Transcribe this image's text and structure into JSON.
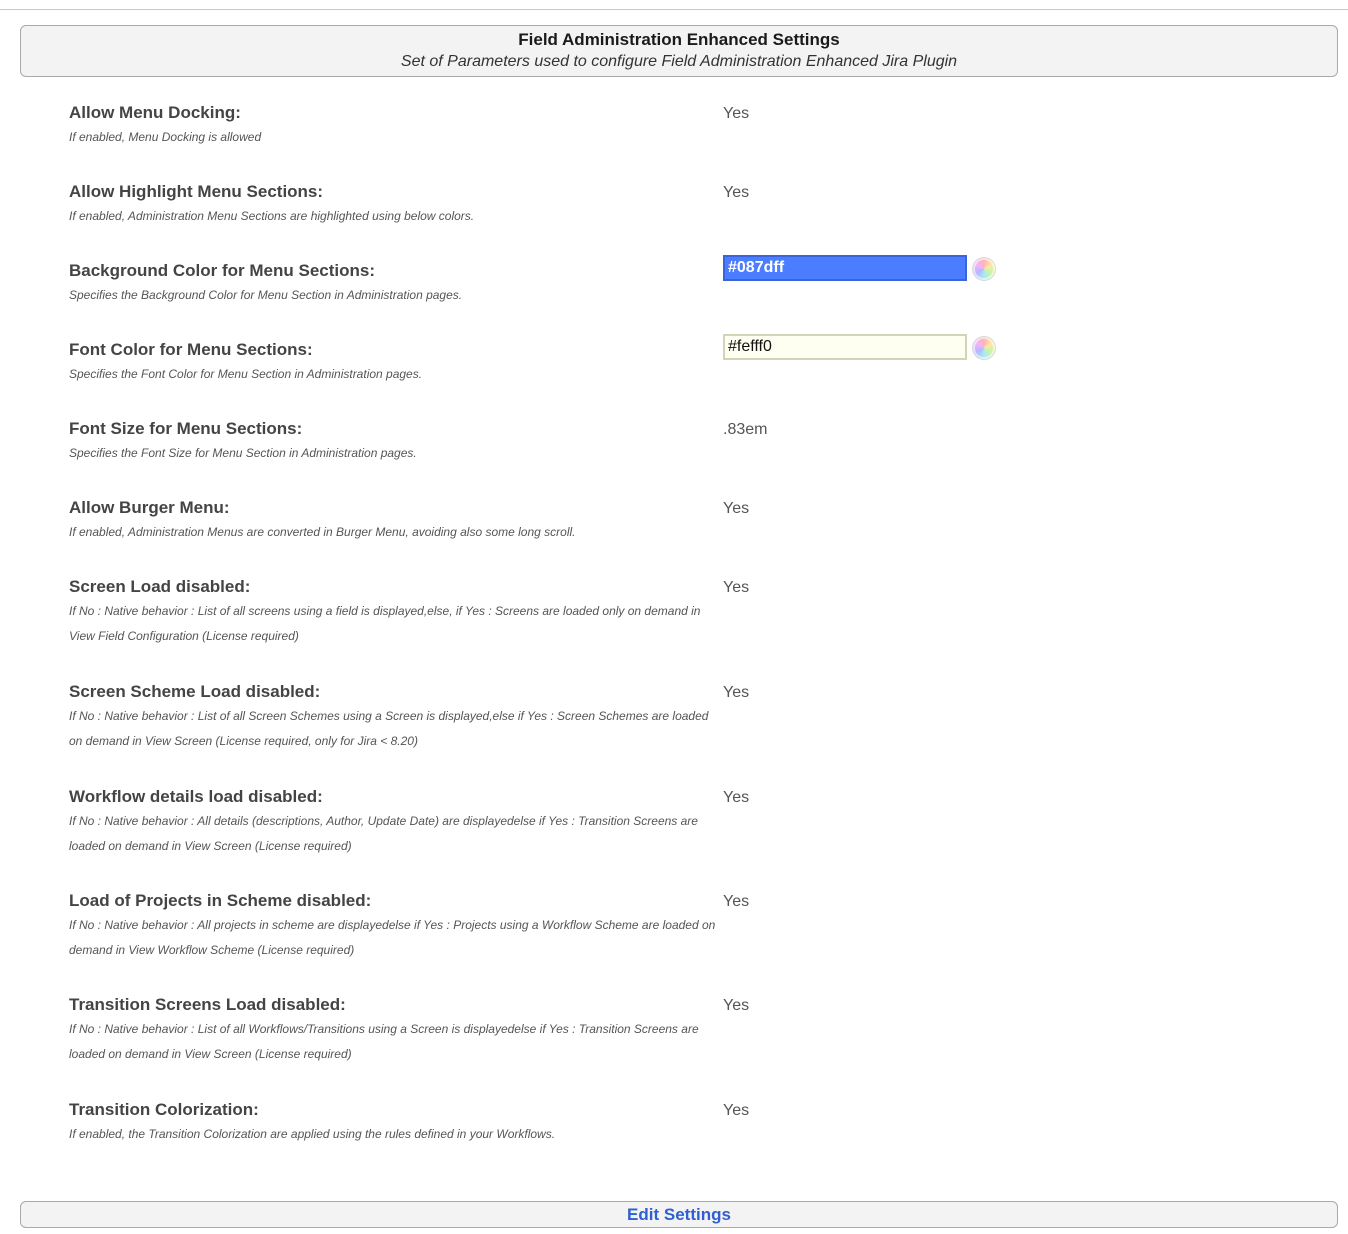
{
  "header": {
    "title": "Field Administration Enhanced Settings",
    "subtitle": "Set of Parameters used to configure Field Administration Enhanced Jira Plugin"
  },
  "settings": [
    {
      "label": "Allow Menu Docking:",
      "description": "If enabled, Menu Docking is allowed",
      "value": "Yes"
    },
    {
      "label": "Allow Highlight Menu Sections:",
      "description": "If enabled, Administration Menu Sections are highlighted using below colors.",
      "value": "Yes"
    },
    {
      "label": "Background Color for Menu Sections:",
      "description": "Specifies the Background Color for Menu Section in Administration pages.",
      "value": "#087dff"
    },
    {
      "label": "Font Color for Menu Sections:",
      "description": "Specifies the Font Color for Menu Section in Administration pages.",
      "value": "#fefff0"
    },
    {
      "label": "Font Size for Menu Sections:",
      "description": "Specifies the Font Size for Menu Section in Administration pages.",
      "value": ".83em"
    },
    {
      "label": "Allow Burger Menu:",
      "description": "If enabled, Administration Menus are converted in Burger Menu, avoiding also some long scroll.",
      "value": "Yes"
    },
    {
      "label": "Screen Load disabled:",
      "description": "If No : Native behavior : List of all screens using a field is displayed,else, if Yes : Screens are loaded only on demand in View Field Configuration (License required)",
      "value": "Yes"
    },
    {
      "label": "Screen Scheme Load disabled:",
      "description": "If No : Native behavior : List of all Screen Schemes using a Screen is displayed,else if Yes : Screen Schemes are loaded on demand in View Screen (License required, only for Jira < 8.20)",
      "value": "Yes"
    },
    {
      "label": "Workflow details load disabled:",
      "description": "If No : Native behavior : All details (descriptions, Author, Update Date) are displayedelse if Yes : Transition Screens are loaded on demand in View Screen (License required)",
      "value": "Yes"
    },
    {
      "label": "Load of Projects in Scheme disabled:",
      "description": "If No : Native behavior : All projects in scheme are displayedelse if Yes : Projects using a Workflow Scheme are loaded on demand in View Workflow Scheme (License required)",
      "value": "Yes"
    },
    {
      "label": "Transition Screens Load disabled:",
      "description": "If No : Native behavior : List of all Workflows/Transitions using a Screen is displayedelse if Yes : Transition Screens are loaded on demand in View Screen (License required)",
      "value": "Yes"
    },
    {
      "label": "Transition Colorization:",
      "description": "If enabled, the Transition Colorization are applied using the rules defined in your Workflows.",
      "value": "Yes"
    }
  ],
  "colors": {
    "background_swatch": "#087dff",
    "font_swatch": "#fefff0",
    "link": "#2f5fd0"
  },
  "icons": {
    "color_picker": "color-wheel-icon"
  },
  "footer": {
    "edit_label": "Edit Settings"
  }
}
